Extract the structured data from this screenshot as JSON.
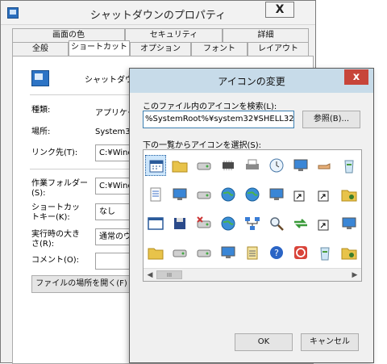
{
  "back_window": {
    "title": "シャットダウンのプロパティ",
    "close_label": "X",
    "tabs_row1": [
      "画面の色",
      "セキュリティ",
      "詳細"
    ],
    "tabs_row2": [
      "全般",
      "ショートカット",
      "オプション",
      "フォント",
      "レイアウト"
    ],
    "active_tab": "ショートカット",
    "shortcut_name": "シャットダウン",
    "type_label": "種類:",
    "type_value": "アプリケーシ",
    "location_label": "場所:",
    "location_value": "System3",
    "target_label": "リンク先(T):",
    "target_value": "C:¥Wind",
    "workdir_label": "作業フォルダー(S):",
    "workdir_value": "C:¥Wind",
    "hotkey_label": "ショートカットキー(K):",
    "hotkey_value": "なし",
    "run_label": "実行時の大きさ(R):",
    "run_value": "通常のウィ",
    "comment_label": "コメント(O):",
    "comment_value": "",
    "open_location_label": "ファイルの場所を開く(F)"
  },
  "dialog": {
    "title": "アイコンの変更",
    "close_label": "x",
    "search_label": "このファイル内のアイコンを検索(L):",
    "path_value": "%SystemRoot%¥system32¥SHELL32.dll",
    "browse_label": "参照(B)...",
    "list_label": "下の一覧からアイコンを選択(S):",
    "scroll_thumb": "III",
    "ok_label": "OK",
    "cancel_label": "キャンセル",
    "icons": [
      "calendar-window-icon",
      "folder-icon",
      "drive-icon",
      "chip-icon",
      "printer-icon",
      "clock-icon",
      "monitor-arrow-icon",
      "hand-icon",
      "recycle-bin-icon",
      "document-icon",
      "computer-icon",
      "network-drive-icon",
      "globe-icon",
      "globe-computer-icon",
      "desktop-icon",
      "cube-shortcut-icon",
      "shortcut-arrow-icon",
      "folder-gear-icon",
      "blank-window-icon",
      "floppy-icon",
      "drive-x-icon",
      "globe-refresh-icon",
      "network-icon",
      "magnifier-icon",
      "arrows-icon",
      "shortcut-small-icon",
      "monitor-icon",
      "folder-open-icon",
      "drive-gray-icon",
      "disc-icon",
      "computer-screen-icon",
      "clipboard-icon",
      "help-icon",
      "power-icon",
      "recycle-full-icon",
      "tools-folder-icon"
    ]
  }
}
